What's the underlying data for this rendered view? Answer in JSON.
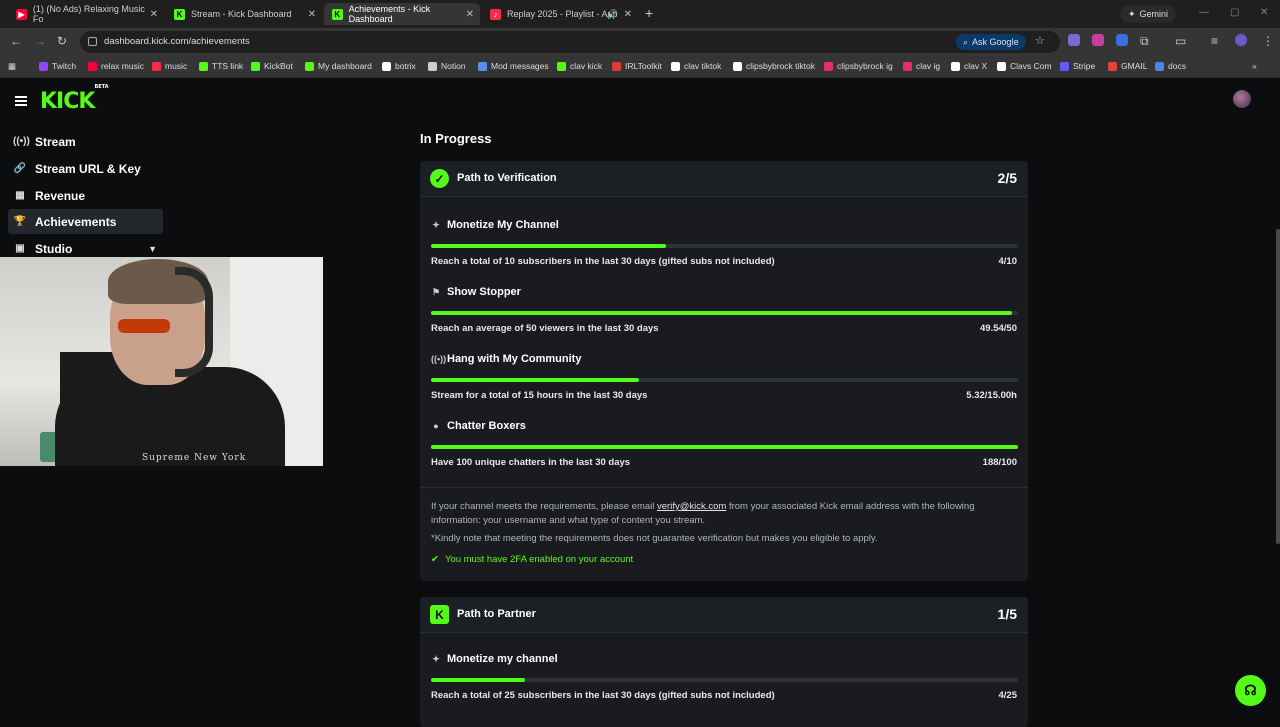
{
  "browser": {
    "tabs": [
      {
        "title": "(1) (No Ads) Relaxing Music Fo",
        "color": "#ff0033",
        "glyph": "▶"
      },
      {
        "title": "Stream - Kick Dashboard",
        "color": "#53fc18",
        "glyph": "K"
      },
      {
        "title": "Achievements - Kick Dashboard",
        "color": "#53fc18",
        "glyph": "K"
      },
      {
        "title": "Replay 2025 - Playlist - App",
        "color": "#fa2d48",
        "glyph": "♪"
      }
    ],
    "gemini_label": "Gemini",
    "url": "dashboard.kick.com/achievements",
    "ask_google_label": "Ask Google",
    "bookmarks": [
      {
        "label": "Twitch",
        "color": "#9146ff"
      },
      {
        "label": "relax music",
        "color": "#ff0033"
      },
      {
        "label": "music",
        "color": "#fa2d48"
      },
      {
        "label": "TTS link",
        "color": "#53fc18"
      },
      {
        "label": "KickBot",
        "color": "#53fc18"
      },
      {
        "label": "My dashboard",
        "color": "#53fc18"
      },
      {
        "label": "botrix",
        "color": "#ffffff"
      },
      {
        "label": "Notion",
        "color": "#cccccc"
      },
      {
        "label": "Mod messages",
        "color": "#5a8dee"
      },
      {
        "label": "clav kick",
        "color": "#53fc18"
      },
      {
        "label": "IRLToolkit",
        "color": "#e23a3a"
      },
      {
        "label": "clav tiktok",
        "color": "#ffffff"
      },
      {
        "label": "clipsbybrock tiktok",
        "color": "#ffffff"
      },
      {
        "label": "clipsbybrock ig",
        "color": "#e1306c"
      },
      {
        "label": "clav ig",
        "color": "#e1306c"
      },
      {
        "label": "clav X",
        "color": "#ffffff"
      },
      {
        "label": "Clavs Com",
        "color": "#ffffff"
      },
      {
        "label": "Stripe",
        "color": "#635bff"
      },
      {
        "label": "GMAIL",
        "color": "#ea4335"
      },
      {
        "label": "docs",
        "color": "#4285f4"
      }
    ]
  },
  "brand": {
    "logo": "KICK",
    "badge": "BETA",
    "accent": "#53fc18"
  },
  "sidebar": {
    "items": [
      {
        "label": "Stream",
        "icon": "broadcast-icon"
      },
      {
        "label": "Stream URL & Key",
        "icon": "link-icon"
      },
      {
        "label": "Revenue",
        "icon": "chart-icon"
      },
      {
        "label": "Achievements",
        "icon": "trophy-icon"
      },
      {
        "label": "Studio",
        "icon": "studio-icon"
      }
    ]
  },
  "webcam": {
    "shirt_text": "Supreme New York"
  },
  "main": {
    "section_title": "In Progress",
    "verification": {
      "title": "Path to Verification",
      "count": "2/5",
      "achievements": [
        {
          "name": "Monetize My Channel",
          "desc": "Reach a total of 10 subscribers in the last 30 days (gifted subs not included)",
          "value": "4/10",
          "progress": 0.4
        },
        {
          "name": "Show Stopper",
          "desc": "Reach an average of 50 viewers in the last 30 days",
          "value": "49.54/50",
          "progress": 0.99
        },
        {
          "name": "Hang with My Community",
          "desc": "Stream for a total of 15 hours in the last 30 days",
          "value": "5.32/15.00h",
          "progress": 0.355
        },
        {
          "name": "Chatter Boxers",
          "desc": "Have 100 unique chatters in the last 30 days",
          "value": "188/100",
          "progress": 1.0
        }
      ],
      "note_1_prefix": "If your channel meets the requirements, please email ",
      "note_1_email": "verify@kick.com",
      "note_1_suffix": " from your associated Kick email address with the following information: your username and what type of content you stream.",
      "note_2": "*Kindly note that meeting the requirements does not guarantee verification but makes you eligible to apply.",
      "twofa": "You must have 2FA enabled on your account"
    },
    "partner": {
      "title": "Path to Partner",
      "count": "1/5",
      "achievements": [
        {
          "name": "Monetize my channel",
          "desc": "Reach a total of 25 subscribers in the last 30 days (gifted subs not included)",
          "value": "4/25",
          "progress": 0.16
        }
      ]
    }
  }
}
